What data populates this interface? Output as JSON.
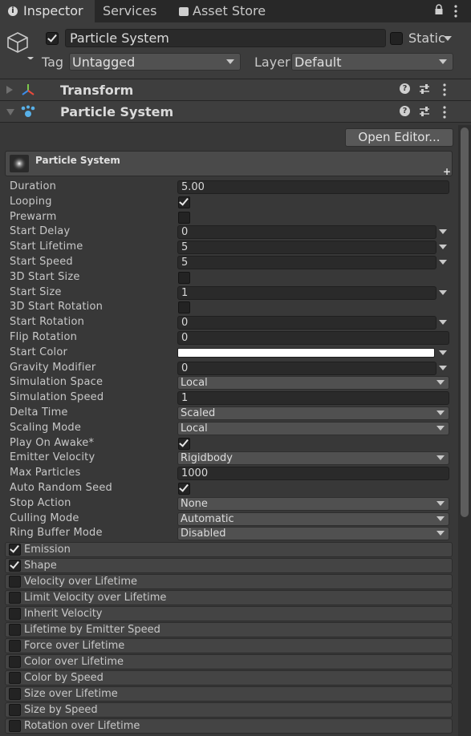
{
  "tabs": [
    {
      "label": "Inspector",
      "icon": "info-icon",
      "active": true
    },
    {
      "label": "Services",
      "icon": "",
      "active": false
    },
    {
      "label": "Asset Store",
      "icon": "shopping-bag-icon",
      "active": false
    }
  ],
  "header": {
    "object_name": "Particle System",
    "active_checked": true,
    "static_label": "Static",
    "static_checked": false,
    "tag_label": "Tag",
    "tag_value": "Untagged",
    "layer_label": "Layer",
    "layer_value": "Default"
  },
  "components": {
    "transform": {
      "title": "Transform"
    },
    "particle_system": {
      "title": "Particle System"
    }
  },
  "open_editor_label": "Open Editor...",
  "main_module_title": "Particle System",
  "properties": [
    {
      "label": "Duration",
      "kind": "field",
      "value": "5.00"
    },
    {
      "label": "Looping",
      "kind": "checkbox",
      "checked": true
    },
    {
      "label": "Prewarm",
      "kind": "checkbox",
      "checked": false
    },
    {
      "label": "Start Delay",
      "kind": "field-curve",
      "value": "0"
    },
    {
      "label": "Start Lifetime",
      "kind": "field-curve",
      "value": "5"
    },
    {
      "label": "Start Speed",
      "kind": "field-curve",
      "value": "5"
    },
    {
      "label": "3D Start Size",
      "kind": "checkbox",
      "checked": false
    },
    {
      "label": "Start Size",
      "kind": "field-curve",
      "value": "1"
    },
    {
      "label": "3D Start Rotation",
      "kind": "checkbox",
      "checked": false
    },
    {
      "label": "Start Rotation",
      "kind": "field-curve",
      "value": "0"
    },
    {
      "label": "Flip Rotation",
      "kind": "field",
      "value": "0"
    },
    {
      "label": "Start Color",
      "kind": "color",
      "value": "#ffffff"
    },
    {
      "label": "Gravity Modifier",
      "kind": "field-curve",
      "value": "0"
    },
    {
      "label": "Simulation Space",
      "kind": "dropdown",
      "value": "Local"
    },
    {
      "label": "Simulation Speed",
      "kind": "field",
      "value": "1"
    },
    {
      "label": "Delta Time",
      "kind": "dropdown",
      "value": "Scaled"
    },
    {
      "label": "Scaling Mode",
      "kind": "dropdown",
      "value": "Local"
    },
    {
      "label": "Play On Awake*",
      "kind": "checkbox",
      "checked": true
    },
    {
      "label": "Emitter Velocity",
      "kind": "dropdown",
      "value": "Rigidbody"
    },
    {
      "label": "Max Particles",
      "kind": "field",
      "value": "1000"
    },
    {
      "label": "Auto Random Seed",
      "kind": "checkbox",
      "checked": true
    },
    {
      "label": "Stop Action",
      "kind": "dropdown",
      "value": "None"
    },
    {
      "label": "Culling Mode",
      "kind": "dropdown",
      "value": "Automatic"
    },
    {
      "label": "Ring Buffer Mode",
      "kind": "dropdown",
      "value": "Disabled"
    }
  ],
  "modules": [
    {
      "label": "Emission",
      "checked": true
    },
    {
      "label": "Shape",
      "checked": true
    },
    {
      "label": "Velocity over Lifetime",
      "checked": false
    },
    {
      "label": "Limit Velocity over Lifetime",
      "checked": false
    },
    {
      "label": "Inherit Velocity",
      "checked": false
    },
    {
      "label": "Lifetime by Emitter Speed",
      "checked": false
    },
    {
      "label": "Force over Lifetime",
      "checked": false
    },
    {
      "label": "Color over Lifetime",
      "checked": false
    },
    {
      "label": "Color by Speed",
      "checked": false
    },
    {
      "label": "Size over Lifetime",
      "checked": false
    },
    {
      "label": "Size by Speed",
      "checked": false
    },
    {
      "label": "Rotation over Lifetime",
      "checked": false
    }
  ],
  "colors": {
    "background": "#383838",
    "panel": "#3c3c3c",
    "field": "#2a2a2a",
    "dropdown": "#505050",
    "text": "#d2d2d2"
  }
}
